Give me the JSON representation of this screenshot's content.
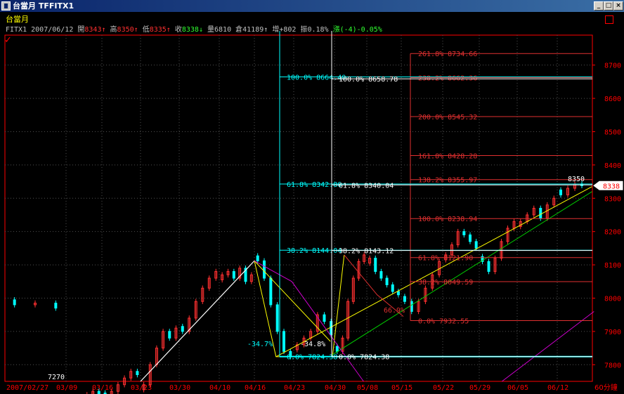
{
  "window": {
    "title": "台當月 TFFITX1",
    "buttons": {
      "minimize": "_",
      "maximize": "□",
      "close": "×"
    }
  },
  "quote": {
    "name": "台當月",
    "symbol": "FITX1",
    "date": "2007/06/12",
    "open_label": "開",
    "open": "8343",
    "open_arrow": "↑",
    "high_label": "高",
    "high": "8350",
    "high_arrow": "↑",
    "low_label": "低",
    "low": "8335",
    "low_arrow": "↑",
    "close_label": "收",
    "close": "8338",
    "close_arrow": "↓",
    "volume_label": "量",
    "volume": "6810",
    "oi_label": "倉",
    "oi": "41189",
    "oi_arrow": "↑",
    "oi_change_label": "增",
    "oi_change": "+802",
    "amplitude_label": "振",
    "amplitude": "0.18%",
    "change_label": "漲",
    "change": "(-4)-0.05%"
  },
  "colors": {
    "background": "#000000",
    "up": "#ff3030",
    "down": "#00ffff",
    "axis": "#ff0000",
    "fib_red": "#e03030",
    "fib_cyan": "#00ffff",
    "fib_white": "#ffffff",
    "trend_yellow": "#ffff00",
    "trend_green": "#00cc00",
    "trend_magenta": "#cc00cc"
  },
  "chart_data": {
    "type": "candlestick",
    "interval_label": "60分鐘",
    "ylim": [
      7750,
      8790
    ],
    "y_ticks": [
      7800,
      7900,
      8000,
      8100,
      8200,
      8300,
      8400,
      8500,
      8600,
      8700
    ],
    "x_labels": [
      "2007/02/27",
      "03/09",
      "03/16",
      "03/23",
      "03/30",
      "04/10",
      "04/16",
      "04/23",
      "04/30",
      "05/08",
      "05/15",
      "05/22",
      "05/29",
      "06/05",
      "06/12"
    ],
    "last_price": "8338",
    "annotations": [
      {
        "text": "8350"
      },
      {
        "text": "7270"
      }
    ],
    "series": [
      {
        "anchor": 0,
        "closes": [
          7980,
          7985,
          7970
        ]
      },
      {
        "anchor": 1,
        "closes": [
          7690,
          7670,
          7680,
          7710,
          7720,
          7700
        ]
      },
      {
        "anchor": 2,
        "closes": [
          7700,
          7720,
          7740,
          7760,
          7780,
          7770
        ]
      },
      {
        "anchor": 3,
        "closes": [
          7740,
          7800,
          7850,
          7900,
          7880,
          7910
        ]
      },
      {
        "anchor": 4,
        "closes": [
          7900,
          7940,
          7990,
          8030,
          8060,
          8080
        ]
      },
      {
        "anchor": 5,
        "closes": [
          8070,
          8080,
          8060,
          8090,
          8050,
          8070
        ]
      },
      {
        "anchor": 6,
        "closes": [
          8112,
          8060,
          7980,
          7900,
          7840,
          7824
        ]
      },
      {
        "anchor": 7,
        "closes": [
          7860,
          7880,
          7900,
          7950,
          7930,
          7890
        ]
      },
      {
        "anchor": 8,
        "closes": [
          7840,
          7880,
          7990,
          8060,
          8110,
          8130
        ]
      },
      {
        "anchor": 9,
        "closes": [
          8120,
          8080,
          8060,
          8040,
          8020,
          8010
        ]
      },
      {
        "anchor": 10,
        "closes": [
          7990,
          7960,
          7990,
          8030,
          8070,
          8110
        ]
      },
      {
        "anchor": 11,
        "closes": [
          8130,
          8160,
          8200,
          8190,
          8170,
          8150
        ]
      },
      {
        "anchor": 12,
        "closes": [
          8110,
          8080,
          8120,
          8170,
          8210,
          8230
        ]
      },
      {
        "anchor": 13,
        "closes": [
          8230,
          8250,
          8270,
          8240,
          8280,
          8300
        ]
      },
      {
        "anchor": 14,
        "closes": [
          8310,
          8330,
          8343,
          8338
        ]
      }
    ],
    "fib_red": [
      {
        "label": "261.8%",
        "value": "8734.66"
      },
      {
        "label": "238.2%",
        "value": "8662.36"
      },
      {
        "label": "200.0%",
        "value": "8545.32"
      },
      {
        "label": "161.8%",
        "value": "8428.28"
      },
      {
        "label": "138.2%",
        "value": "8355.97"
      },
      {
        "label": "100.0%",
        "value": "8238.94"
      },
      {
        "label": "61.8%",
        "value": "8121.90"
      },
      {
        "label": "38.2%",
        "value": "8049.59"
      },
      {
        "label": "0.0%",
        "value": "7932.55"
      }
    ],
    "fib_cyan": [
      {
        "label": "100.0%",
        "value": "8664.40"
      },
      {
        "label": "61.8%",
        "value": "8342.86"
      },
      {
        "label": "38.2%",
        "value": "8144.04"
      },
      {
        "label": "0.0%",
        "value": "7824.38"
      }
    ],
    "fib_white": [
      {
        "label": "100.0%",
        "value": "8658.78"
      },
      {
        "label": "61.8%",
        "value": "8340.04"
      },
      {
        "label": "38.2%",
        "value": "8143.12"
      },
      {
        "label": "0.0%",
        "value": "7824.38"
      }
    ],
    "percent_labels": [
      {
        "text": "-34.7%",
        "color": "cyan"
      },
      {
        "text": "-34.8%",
        "color": "white"
      },
      {
        "text": "66.9%",
        "color": "red"
      }
    ]
  }
}
